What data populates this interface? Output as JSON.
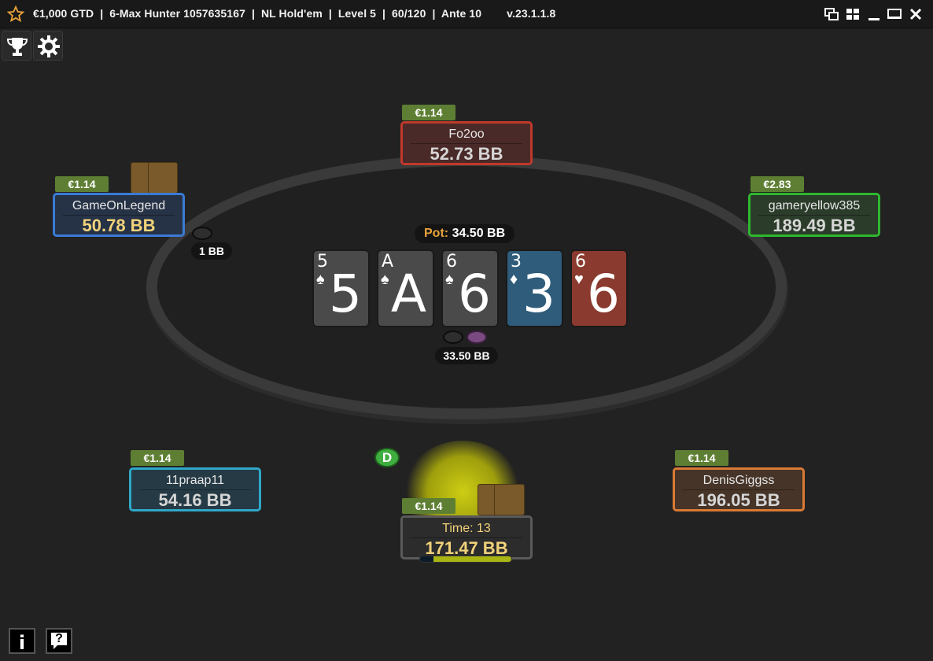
{
  "titlebar": {
    "title": "€1,000 GTD  |  6-Max Hunter 1057635167  |  NL Hold'em  |  Level 5  |  60/120  |  Ante 10        v.23.1.1.8",
    "icons": [
      "favorite-star-icon",
      "window-tile-icon",
      "window-grid-icon",
      "minimize-icon",
      "maximize-icon",
      "close-icon"
    ]
  },
  "toolbar": {
    "icons": [
      "trophy-icon",
      "settings-gear-icon"
    ]
  },
  "colors": {
    "accent_gold": "#e8a33a",
    "bounty_green": "#5e7f33",
    "seat_top": "#c0392b",
    "seat_left_top": "#3a7bd5",
    "seat_right_top": "#2eb82e",
    "seat_left_bottom": "#2fa8c8",
    "seat_right_bottom": "#d97a35",
    "seat_hero": "#5a5a5a"
  },
  "seats": {
    "top": {
      "name": "Fo2oo",
      "stack": "52.73 BB",
      "bounty": "€1.14"
    },
    "left_top": {
      "name": "GameOnLegend",
      "stack": "50.78 BB",
      "bounty": "€1.14"
    },
    "right_top": {
      "name": "gameryellow385",
      "stack": "189.49 BB",
      "bounty": "€2.83"
    },
    "left_bottom": {
      "name": "11praap11",
      "stack": "54.16 BB",
      "bounty": "€1.14"
    },
    "right_bottom": {
      "name": "DenisGiggss",
      "stack": "196.05 BB",
      "bounty": "€1.14"
    },
    "hero": {
      "name": "Time: 13",
      "stack": "171.47 BB",
      "bounty": "€1.14",
      "time_remaining_fraction": 0.85
    }
  },
  "pot": {
    "label": "Pot:",
    "value": "34.50 BB"
  },
  "bets": {
    "left_top": "1 BB",
    "center": "33.50 BB"
  },
  "board": [
    {
      "rank": "5",
      "suit": "♠",
      "color": "#4a4a4a"
    },
    {
      "rank": "A",
      "suit": "♠",
      "color": "#4a4a4a"
    },
    {
      "rank": "6",
      "suit": "♠",
      "color": "#4a4a4a"
    },
    {
      "rank": "3",
      "suit": "♦",
      "color": "#2f5c7a"
    },
    {
      "rank": "6",
      "suit": "♥",
      "color": "#8a3a2e"
    }
  ],
  "dealer": {
    "label": "D"
  },
  "footer": {
    "info_label": "i",
    "help_label": "?"
  }
}
